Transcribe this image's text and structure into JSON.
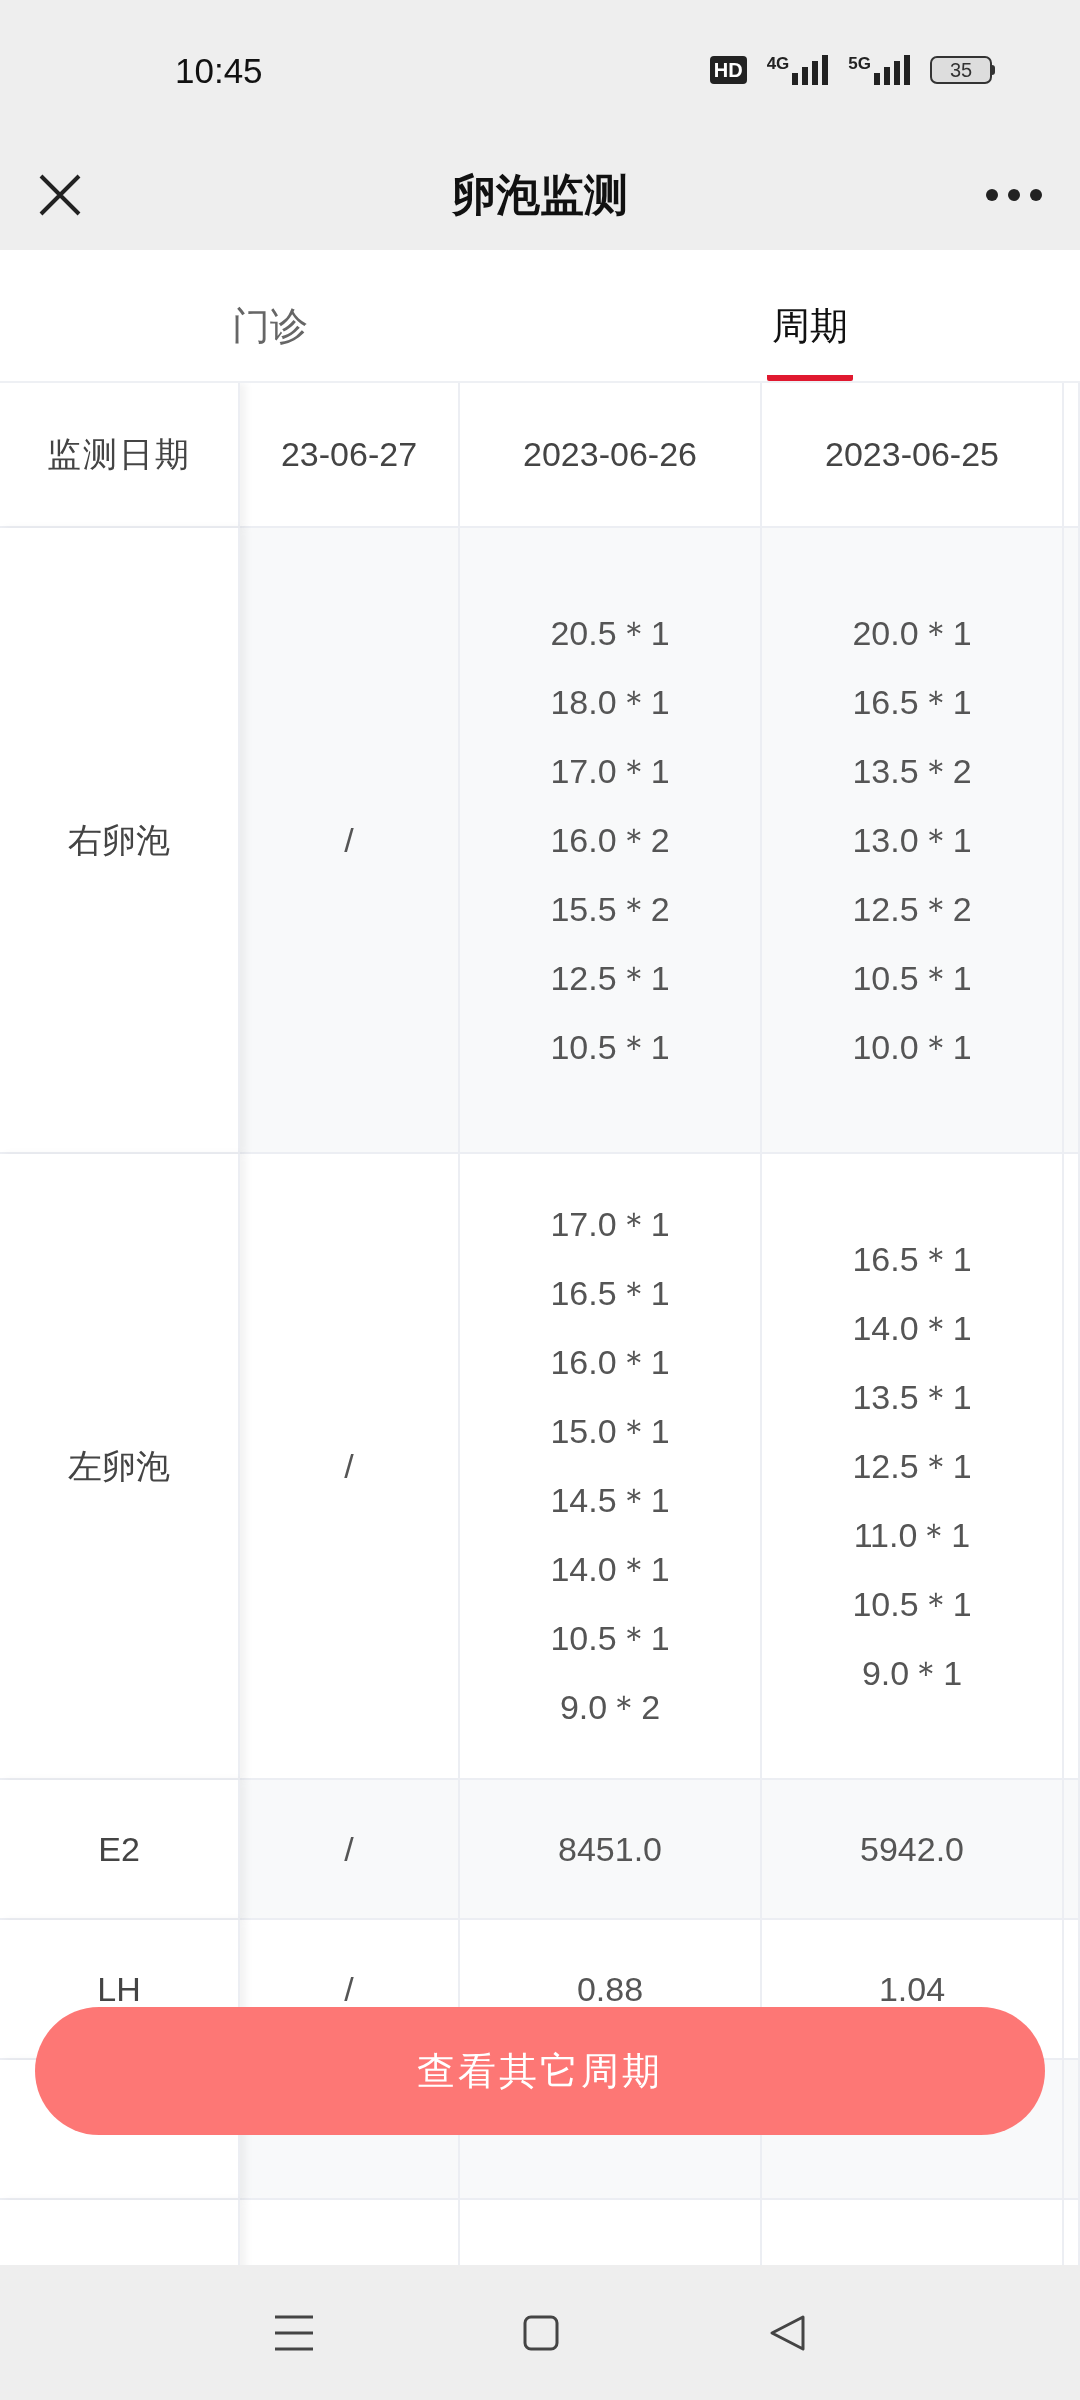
{
  "status_bar": {
    "time": "10:45",
    "hd_badge": "HD",
    "network_1": "4G",
    "network_2": "5G",
    "battery": "35"
  },
  "header": {
    "title": "卵泡监测"
  },
  "tabs": [
    {
      "label": "门诊",
      "selected": false
    },
    {
      "label": "周期",
      "selected": true
    }
  ],
  "table": {
    "columns": [
      "监测日期",
      "23-06-27",
      "2023-06-26",
      "2023-06-25"
    ],
    "rows": [
      {
        "kind": "sizes",
        "cells": [
          [
            "右卵泡"
          ],
          [
            "/"
          ],
          [
            "20.5＊1",
            "18.0＊1",
            "17.0＊1",
            "16.0＊2",
            "15.5＊2",
            "12.5＊1",
            "10.5＊1"
          ],
          [
            "20.0＊1",
            "16.5＊1",
            "13.5＊2",
            "13.0＊1",
            "12.5＊2",
            "10.5＊1",
            "10.0＊1"
          ]
        ]
      },
      {
        "kind": "sizes",
        "cells": [
          [
            "左卵泡"
          ],
          [
            "/"
          ],
          [
            "17.0＊1",
            "16.5＊1",
            "16.0＊1",
            "15.0＊1",
            "14.5＊1",
            "14.0＊1",
            "10.5＊1",
            "9.0＊2"
          ],
          [
            "16.5＊1",
            "14.0＊1",
            "13.5＊1",
            "12.5＊1",
            "11.0＊1",
            "10.5＊1",
            "9.0＊1"
          ]
        ]
      },
      {
        "kind": "value",
        "cells": [
          [
            "E2"
          ],
          [
            "/"
          ],
          [
            "8451.0"
          ],
          [
            "5942.0"
          ]
        ]
      },
      {
        "kind": "value",
        "cells": [
          [
            "LH"
          ],
          [
            "/"
          ],
          [
            "0.88"
          ],
          [
            "1.04"
          ]
        ]
      }
    ]
  },
  "action_button": {
    "label": "查看其它周期"
  }
}
